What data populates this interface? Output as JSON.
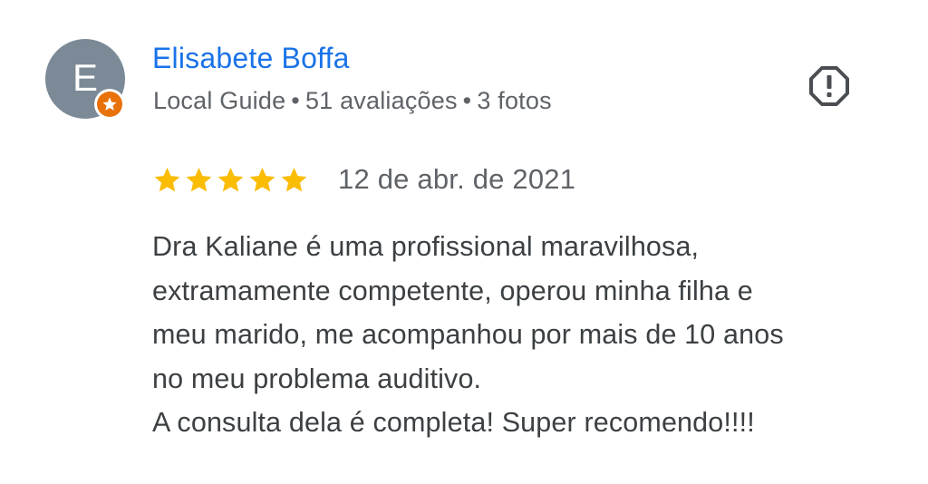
{
  "review": {
    "author": {
      "avatar_letter": "E",
      "name": "Elisabete Boffa",
      "guide_label": "Local Guide",
      "separator": "•",
      "reviews_count": "51 avaliações",
      "photos_count": "3 fotos",
      "badge_icon": "star-icon",
      "avatar_color": "#7b8a96",
      "badge_color": "#e8710a",
      "name_color": "#1a73e8"
    },
    "report_icon": "report-octagon-icon",
    "rating": 5,
    "rating_max": 5,
    "star_color": "#fbbc04",
    "date": "12 de abr. de 2021",
    "text_lines": [
      "Dra Kaliane é uma profissional maravilhosa,",
      "extramamente competente, operou minha filha e",
      "meu marido, me acompanhou por mais de 10 anos",
      "no meu problema auditivo.",
      "A consulta dela é completa! Super recomendo!!!!"
    ]
  }
}
